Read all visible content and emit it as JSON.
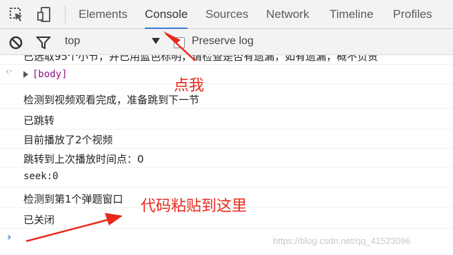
{
  "tabs": [
    {
      "label": "Elements",
      "active": false
    },
    {
      "label": "Console",
      "active": true
    },
    {
      "label": "Sources",
      "active": false
    },
    {
      "label": "Network",
      "active": false
    },
    {
      "label": "Timeline",
      "active": false
    },
    {
      "label": "Profiles",
      "active": false
    }
  ],
  "toolbar": {
    "context": "top",
    "preserve_log_label": "Preserve log",
    "preserve_log_checked": false
  },
  "console": {
    "messages": [
      "已选取95个小节，并已用蓝色标明，请检查是否有遗漏，如有遗漏，概不负责",
      "[body]",
      "检测到视频观看完成，准备跳到下一节",
      "已跳转",
      "目前播放了2个视频",
      "跳转到上次播放时间点：0",
      "seek:0",
      "检测到第1个弹题窗口",
      "已关闭"
    ],
    "prompt_symbol": "›"
  },
  "annotations": {
    "click_me": "点我",
    "paste_here": "代码粘贴到这里"
  },
  "watermark": "https://blog.csdn.net/qq_41523096",
  "colors": {
    "accent": "#3879d9",
    "annotation": "#e8291c"
  }
}
